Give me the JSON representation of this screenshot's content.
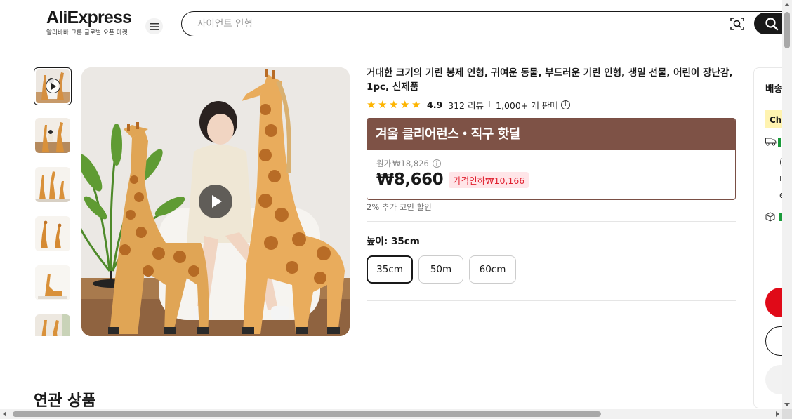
{
  "header": {
    "logo_text": "AliExpress",
    "logo_subtitle": "알리바바 그룹 글로벌 오픈 마켓",
    "search_placeholder": "자이언트 인형"
  },
  "product": {
    "title": "거대한 크기의 기린 봉제 인형, 귀여운 동물, 부드러운 기린 인형, 생일 선물, 어린이 장난감, 1pc, 신제품",
    "rating": "4.9",
    "reviews": "312 리뷰",
    "sold": "1,000+ 개 판매",
    "promo_banner": "겨울 클리어런스・직구 핫딜",
    "original_price_label": "원가",
    "original_price": "₩18,826",
    "price": "₩8,660",
    "discount": "가격인하₩10,166",
    "coin_note": "2% 추가 코인 할인",
    "variant_label": "높이: 35cm",
    "variants": [
      {
        "label": "35cm",
        "selected": true
      },
      {
        "label": "50m",
        "selected": false
      },
      {
        "label": "60cm",
        "selected": false
      }
    ],
    "rating_stars": 5
  },
  "gallery": {
    "thumbnails": [
      {
        "name": "thumbnail-video"
      },
      {
        "name": "thumbnail-2"
      },
      {
        "name": "thumbnail-3"
      },
      {
        "name": "thumbnail-4"
      },
      {
        "name": "thumbnail-5"
      },
      {
        "name": "thumbnail-6"
      }
    ]
  },
  "sections": {
    "related_title": "연관 상품"
  },
  "right_panel": {
    "title": "배송",
    "choice_label": "Ch"
  },
  "colors": {
    "banner_bg": "#7e5246",
    "discount_text": "#e0202f",
    "discount_bg": "#ffe5e8",
    "star": "#fdb400",
    "buy_button": "#e00a18"
  }
}
